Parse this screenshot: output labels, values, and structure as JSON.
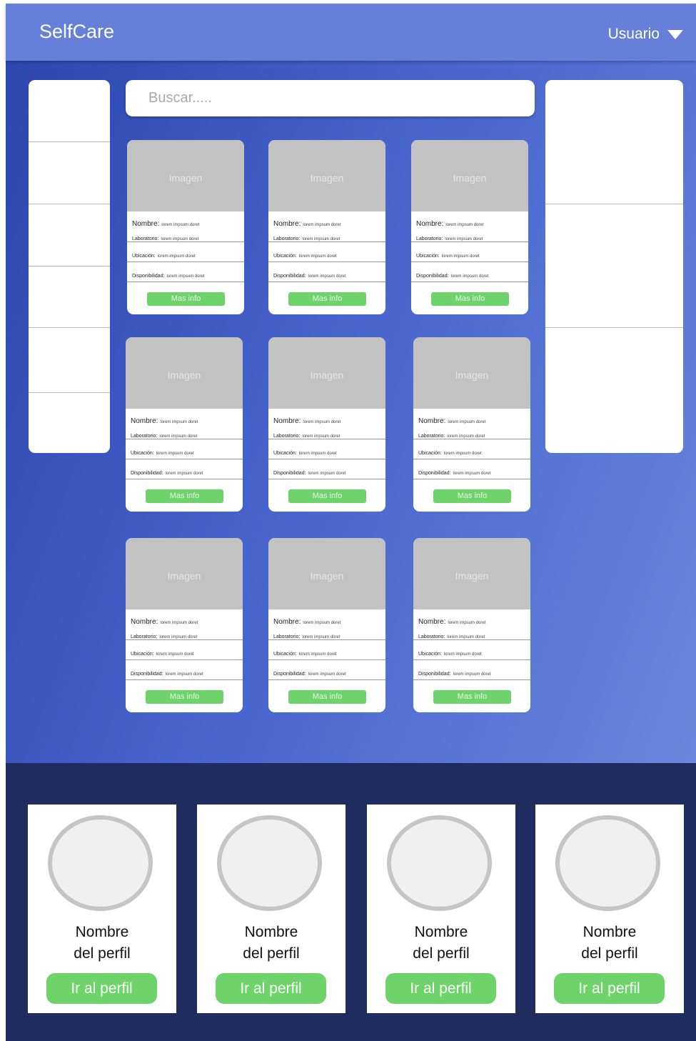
{
  "header": {
    "brand": "SelfCare",
    "user_menu_label": "Usuario"
  },
  "search": {
    "placeholder": "Buscar....."
  },
  "product_card": {
    "image_label": "Imagen",
    "nombre_label": "Nombre:",
    "nombre_value": "lorem impsum doret",
    "laboratorio_label": "Laboratorio:",
    "laboratorio_value": "lorem impsum doret",
    "ubicacion_label": "Ubicación:",
    "ubicacion_value": "lorem impsum doret",
    "disponibilidad_label": "Disponibilidad:",
    "disponibilidad_value": "lorem impsum doret",
    "button_label": "Mas info"
  },
  "profiles": [
    {
      "name_line1": "Nombre",
      "name_line2": "del perfil",
      "button_label": "Ir al perfil"
    },
    {
      "name_line1": "Nombre",
      "name_line2": "del perfil",
      "button_label": "Ir al perfil"
    },
    {
      "name_line1": "Nombre",
      "name_line2": "del perfil",
      "button_label": "Ir al perfil"
    },
    {
      "name_line1": "Nombre",
      "name_line2": "del perfil",
      "button_label": "Ir al perfil"
    }
  ],
  "colors": {
    "header": "#6680d9",
    "main_gradient_start": "#2d46b0",
    "main_gradient_end": "#6887db",
    "footer": "#1e2c60",
    "accent_green": "#6fd36b",
    "image_placeholder": "#c2c2c2"
  }
}
